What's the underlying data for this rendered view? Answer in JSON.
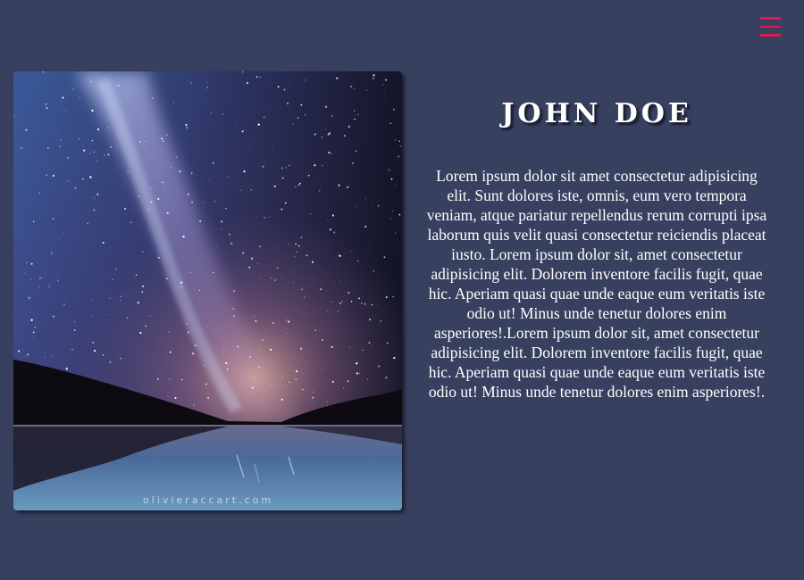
{
  "header": {
    "menu_icon": "hamburger-menu-icon",
    "menu_color": "#e0194f"
  },
  "profile": {
    "name": "JOHN DOE",
    "bio": "Lorem ipsum dolor sit amet consectetur adipisicing elit. Sunt dolores iste, omnis, eum vero tempora veniam, atque pariatur repellendus rerum corrupti ipsa laborum quis velit quasi consectetur reiciendis placeat iusto. Lorem ipsum dolor sit, amet consectetur adipisicing elit. Dolorem inventore facilis fugit, quae hic. Aperiam quasi quae unde eaque eum veritatis iste odio ut! Minus unde tenetur dolores enim asperiores!.Lorem ipsum dolor sit, amet consectetur adipisicing elit. Dolorem inventore facilis fugit, quae hic. Aperiam quasi quae unde eaque eum veritatis iste odio ut! Minus unde tenetur dolores enim asperiores!.",
    "photo_watermark": "olivieraccart.com"
  },
  "colors": {
    "background": "#384060",
    "text": "#ffffff"
  }
}
